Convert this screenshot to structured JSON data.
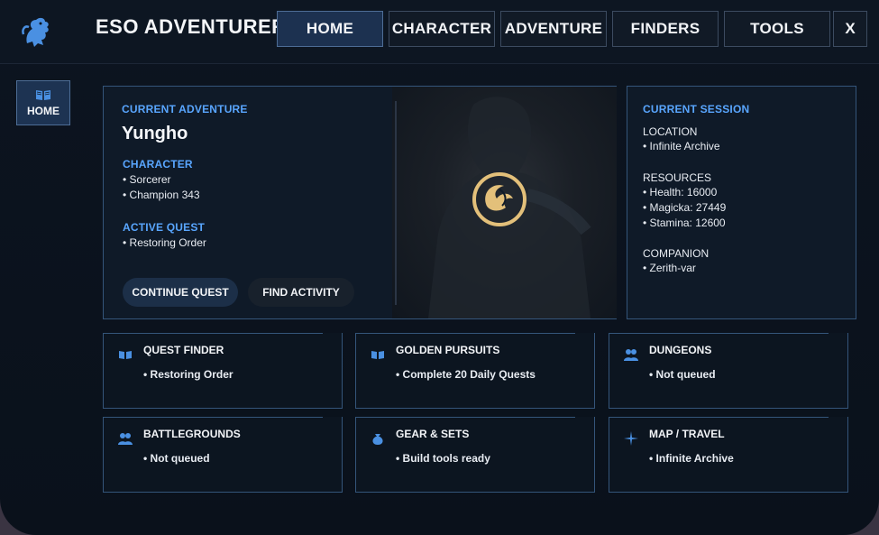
{
  "header": {
    "app_title": "ESO ADVENTURER",
    "nav": [
      {
        "label": "HOME",
        "active": true
      },
      {
        "label": "CHARACTER",
        "active": false
      },
      {
        "label": "ADVENTURE",
        "active": false
      },
      {
        "label": "FINDERS",
        "active": false
      },
      {
        "label": "TOOLS",
        "active": false
      }
    ],
    "close_label": "X"
  },
  "sidebar": {
    "home_label": "HOME",
    "home_icon": "book-icon"
  },
  "adventure": {
    "section_label": "CURRENT ADVENTURE",
    "character_name": "Yungho",
    "character_label": "CHARACTER",
    "character_lines": [
      "• Sorcerer",
      "• Champion 343"
    ],
    "quest_label": "ACTIVE QUEST",
    "quest_lines": [
      "• Restoring Order"
    ],
    "continue_button": "CONTINUE QUEST",
    "find_button": "FIND ACTIVITY",
    "emblem_icon": "sorcerer-emblem-icon"
  },
  "session": {
    "section_label": "CURRENT SESSION",
    "location_label": "LOCATION",
    "location_value": "• Infinite Archive",
    "resources_label": "RESOURCES",
    "resources": [
      "• Health: 16000",
      "• Magicka: 27449",
      "• Stamina: 12600"
    ],
    "companion_label": "COMPANION",
    "companion_value": "• Zerith-var"
  },
  "cards": [
    {
      "title": "QUEST FINDER",
      "value": "• Restoring Order",
      "icon": "book-icon"
    },
    {
      "title": "GOLDEN PURSUITS",
      "value": "• Complete 20 Daily Quests",
      "icon": "book-icon"
    },
    {
      "title": "DUNGEONS",
      "value": "• Not queued",
      "icon": "group-icon"
    },
    {
      "title": "BATTLEGROUNDS",
      "value": "• Not queued",
      "icon": "group-icon"
    },
    {
      "title": "GEAR & SETS",
      "value": "• Build tools ready",
      "icon": "bag-icon"
    },
    {
      "title": "MAP / TRAVEL",
      "value": "• Infinite Archive",
      "icon": "compass-icon"
    }
  ],
  "colors": {
    "accent": "#59a6ff",
    "panel_border": "#34557a",
    "active_nav": "#1c3150",
    "emblem": "#e3c07a"
  }
}
